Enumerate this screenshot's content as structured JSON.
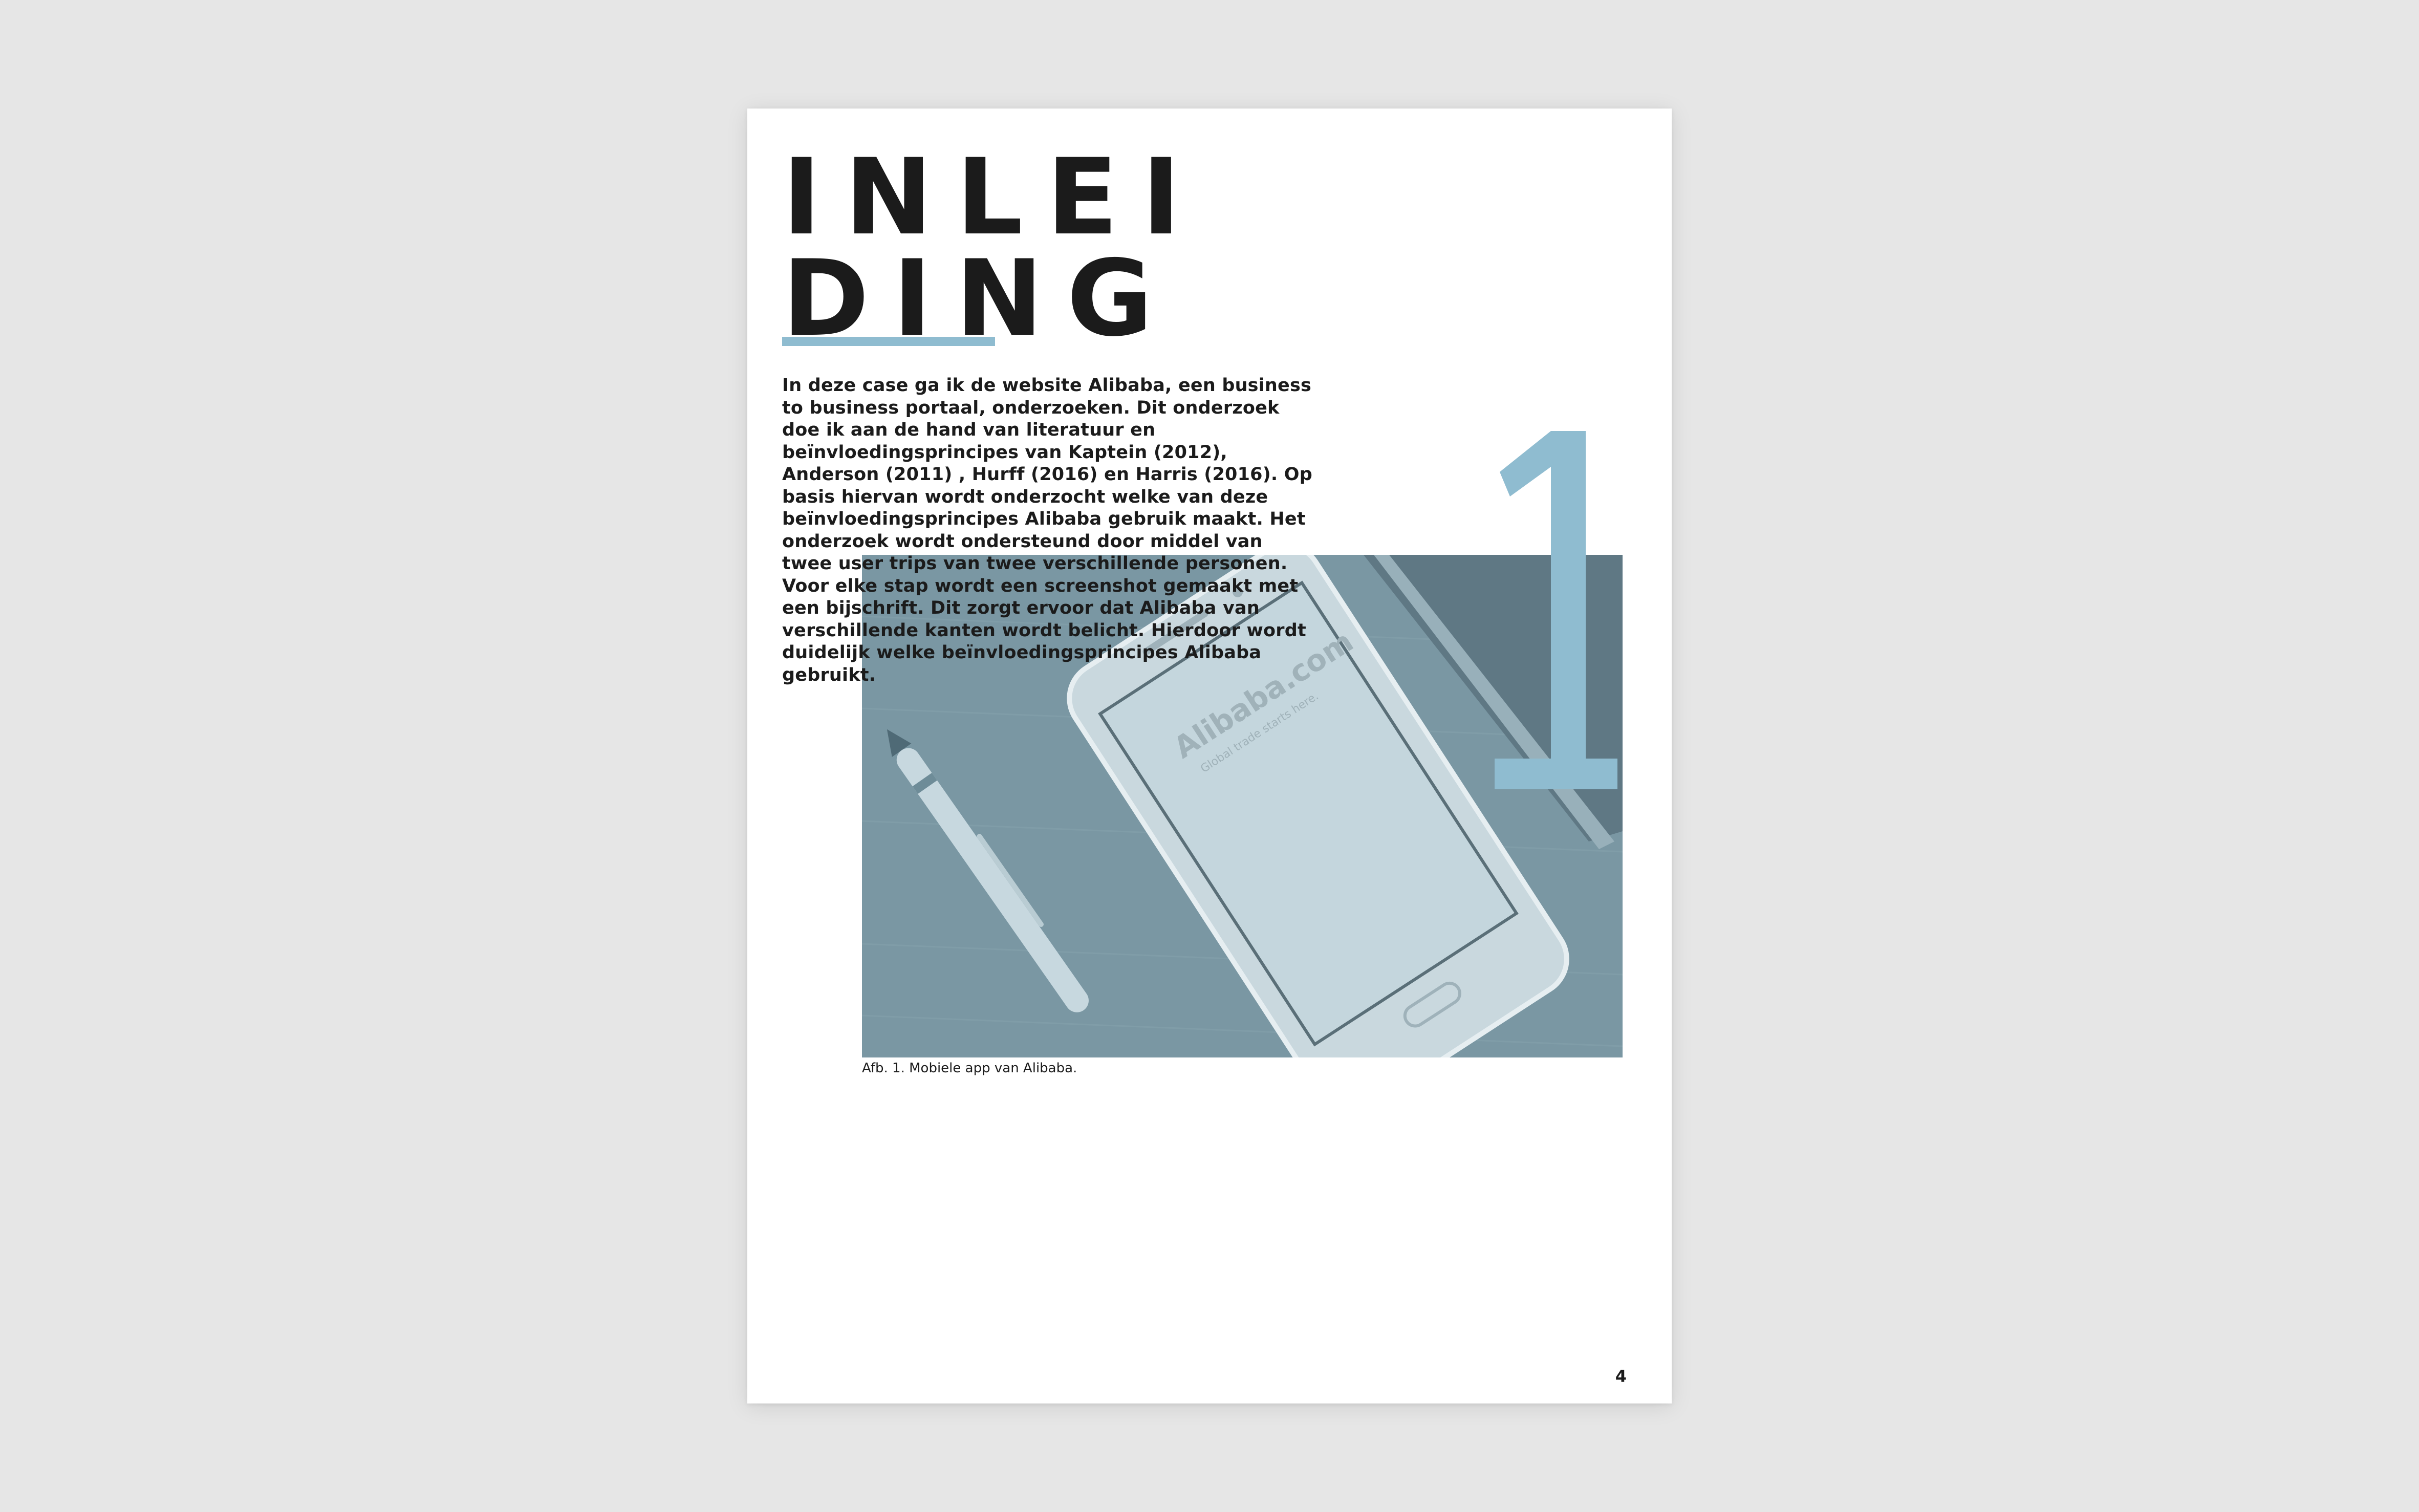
{
  "page": {
    "title_line_1": "INLEI",
    "title_line_2": "DING",
    "chapter_number": "1",
    "intro_text": "In deze case ga ik de website Alibaba, een business to business portaal, onderzoeken. Dit onderzoek doe ik aan de hand van literatuur en beïnvloedingsprincipes van Kaptein (2012), Anderson (2011) , Hurff (2016) en Harris (2016). Op basis hiervan wordt onderzocht welke van deze beïnvloedingsprincipes Alibaba gebruik maakt. Het onderzoek wordt ondersteund door middel van twee user trips van twee verschillende personen. Voor elke stap wordt een screenshot gemaakt met een bijschrift. Dit zorgt ervoor dat Alibaba van verschillende kanten wordt belicht. Hierdoor wordt duidelijk welke beïnvloedingsprincipes Alibaba gebruikt.",
    "figure_caption": "Afb. 1. Mobiele app van Alibaba.",
    "page_number": "4"
  },
  "photo": {
    "logo_wordmark": "Alibaba.com",
    "logo_tagline": "Global trade starts here."
  },
  "colors": {
    "accent": "#8fbcd0",
    "photo_tint": "#6f8c98",
    "text": "#1b1b1b",
    "background": "#e6e6e6"
  }
}
